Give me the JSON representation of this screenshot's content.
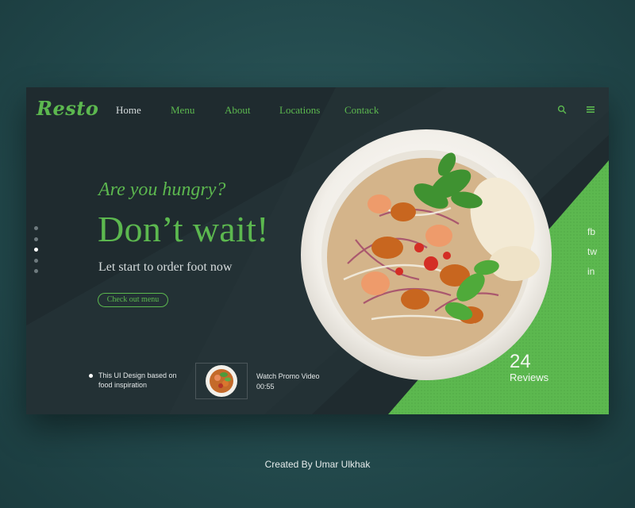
{
  "brand": {
    "logo": "Resto"
  },
  "nav": {
    "items": [
      {
        "label": "Home",
        "active": true
      },
      {
        "label": "Menu",
        "active": false
      },
      {
        "label": "About",
        "active": false
      },
      {
        "label": "Locations",
        "active": false
      },
      {
        "label": "Contack",
        "active": false
      }
    ],
    "icons": [
      "search-icon",
      "menu-icon"
    ]
  },
  "slider": {
    "count": 5,
    "active_index": 2
  },
  "hero": {
    "tagline": "Are you hungry?",
    "headline": "Don’t wait!",
    "subline": "Let start to order foot now",
    "cta": "Check out menu"
  },
  "info": {
    "text": "This UI Design based on food inspiration"
  },
  "promo": {
    "label": "Watch Promo Video",
    "duration": "00:55"
  },
  "social": {
    "links": [
      "fb",
      "tw",
      "in"
    ]
  },
  "reviews": {
    "count": "24",
    "label": "Reviews"
  },
  "credit": "Created By Umar Ulkhak",
  "colors": {
    "accent": "#5cb84f",
    "card_bg": "#1f2b2f",
    "page_bg": "#234a4d",
    "text_light": "#d6dcdd"
  }
}
